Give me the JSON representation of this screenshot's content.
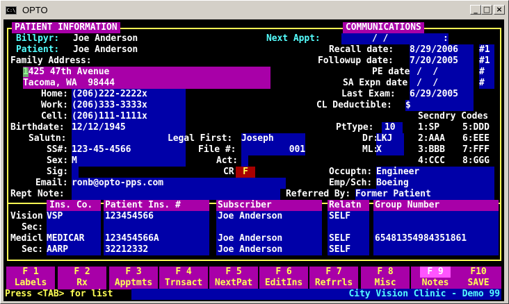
{
  "window": {
    "title": "OPTO",
    "icon": "console-icon"
  },
  "console": {
    "patient_info": "PATIENT INFORMATION",
    "communications": "COMMUNICATIONS",
    "billpyr_label": "Billpyr:",
    "billpyr_value": "Joe Anderson",
    "next_appt_label": "Next Appt:",
    "next_appt_value": "/ /",
    "patient_label": "Patient:",
    "patient_value": "Joe Anderson",
    "family_address_label": "Family Address:",
    "address_line1": "1425 47th Avenue",
    "address_line2": "Tacoma, WA  98444",
    "recall_label": "Recall date:",
    "recall_value": "8/29/2006",
    "recall_num": "#1",
    "followup_label": "Followup date:",
    "followup_value": "7/20/2005",
    "followup_num": "#1",
    "pe_label": "PE date:",
    "pe_value": "/  /",
    "pe_num": "#",
    "sa_label": "SA Expn date:",
    "sa_value": "/  /",
    "sa_num": "#",
    "last_exam_label": "Last Exam:",
    "last_exam_value": "6/29/2005",
    "cl_label": "CL Deductible:",
    "cl_value": "$",
    "home_label": "Home:",
    "home_value": "(206)222-2222x",
    "work_label": "Work:",
    "work_value": "(206)333-3333x",
    "cell_label": "Cell:",
    "cell_value": "(206)111-1111x",
    "secondary_codes": "Secndry Codes",
    "birthdate_label": "Birthdate:",
    "birthdate_value": "12/12/1945",
    "pttype_label": "PtType:",
    "pttype_value": "10",
    "code1": "1:SP",
    "code5": "5:DDD",
    "salutn_label": "Salutn:",
    "legal_first_label": "Legal First:",
    "legal_first_value": "Joseph",
    "dr_label": "Dr:",
    "dr_value": "LKJ",
    "code2": "2:AAA",
    "code6": "6:EEE",
    "ss_label": "SS#:",
    "ss_value": "123-45-4566",
    "file_label": "File #:",
    "file_value": "001",
    "ml_label": "ML:",
    "ml_value": "X",
    "code3": "3:BBB",
    "code7": "7:FFF",
    "sex_label": "Sex:",
    "sex_value": "M",
    "act_label": "Act:",
    "code4": "4:CCC",
    "code8": "8:GGG",
    "sig_label": "Sig:",
    "cr_label": "CR",
    "cr_value": "F",
    "occuptn_label": "Occuptn:",
    "occuptn_value": "Engineer",
    "email_label": "Email:",
    "email_value": "ronb@opto-pps.com",
    "empsch_label": "Emp/Sch:",
    "empsch_value": "Boeing",
    "rept_note_label": "Rept Note:",
    "referred_label": "Referred By:",
    "referred_value": "Former Patient",
    "ins_headers": [
      "Ins. Co.",
      "Patient Ins. #",
      "Subscriber",
      "Relatn",
      "Group Number"
    ],
    "ins_rows": [
      {
        "label": "Vision",
        "co": "VSP",
        "num": "123454566",
        "sub": "Joe Anderson",
        "rel": "SELF",
        "grp": ""
      },
      {
        "label": "Sec:",
        "co": "",
        "num": "",
        "sub": "",
        "rel": "",
        "grp": ""
      },
      {
        "label": "Medicl",
        "co": "MEDICAR",
        "num": "123454566A",
        "sub": "Joe Anderson",
        "rel": "SELF",
        "grp": "65481354984351861"
      },
      {
        "label": "Sec:",
        "co": "AARP",
        "num": "32212332",
        "sub": "Joe Anderson",
        "rel": "SELF",
        "grp": ""
      }
    ]
  },
  "fkeys": [
    {
      "key": "F 1",
      "label": "Labels"
    },
    {
      "key": "F 2",
      "label": "Rx"
    },
    {
      "key": "F 3",
      "label": "Apptmts"
    },
    {
      "key": "F 4",
      "label": "Trnsact"
    },
    {
      "key": "F 5",
      "label": "NextPat"
    },
    {
      "key": "F 6",
      "label": "EditIns"
    },
    {
      "key": "F 7",
      "label": "Refrrls"
    },
    {
      "key": "F 8",
      "label": "Misc"
    },
    {
      "key": "F 9",
      "label": "Notes"
    },
    {
      "key": "F10",
      "label": "SAVE"
    }
  ],
  "status": {
    "left": "Press <TAB> for list",
    "right": "City Vision Clinic - Demo 99"
  }
}
